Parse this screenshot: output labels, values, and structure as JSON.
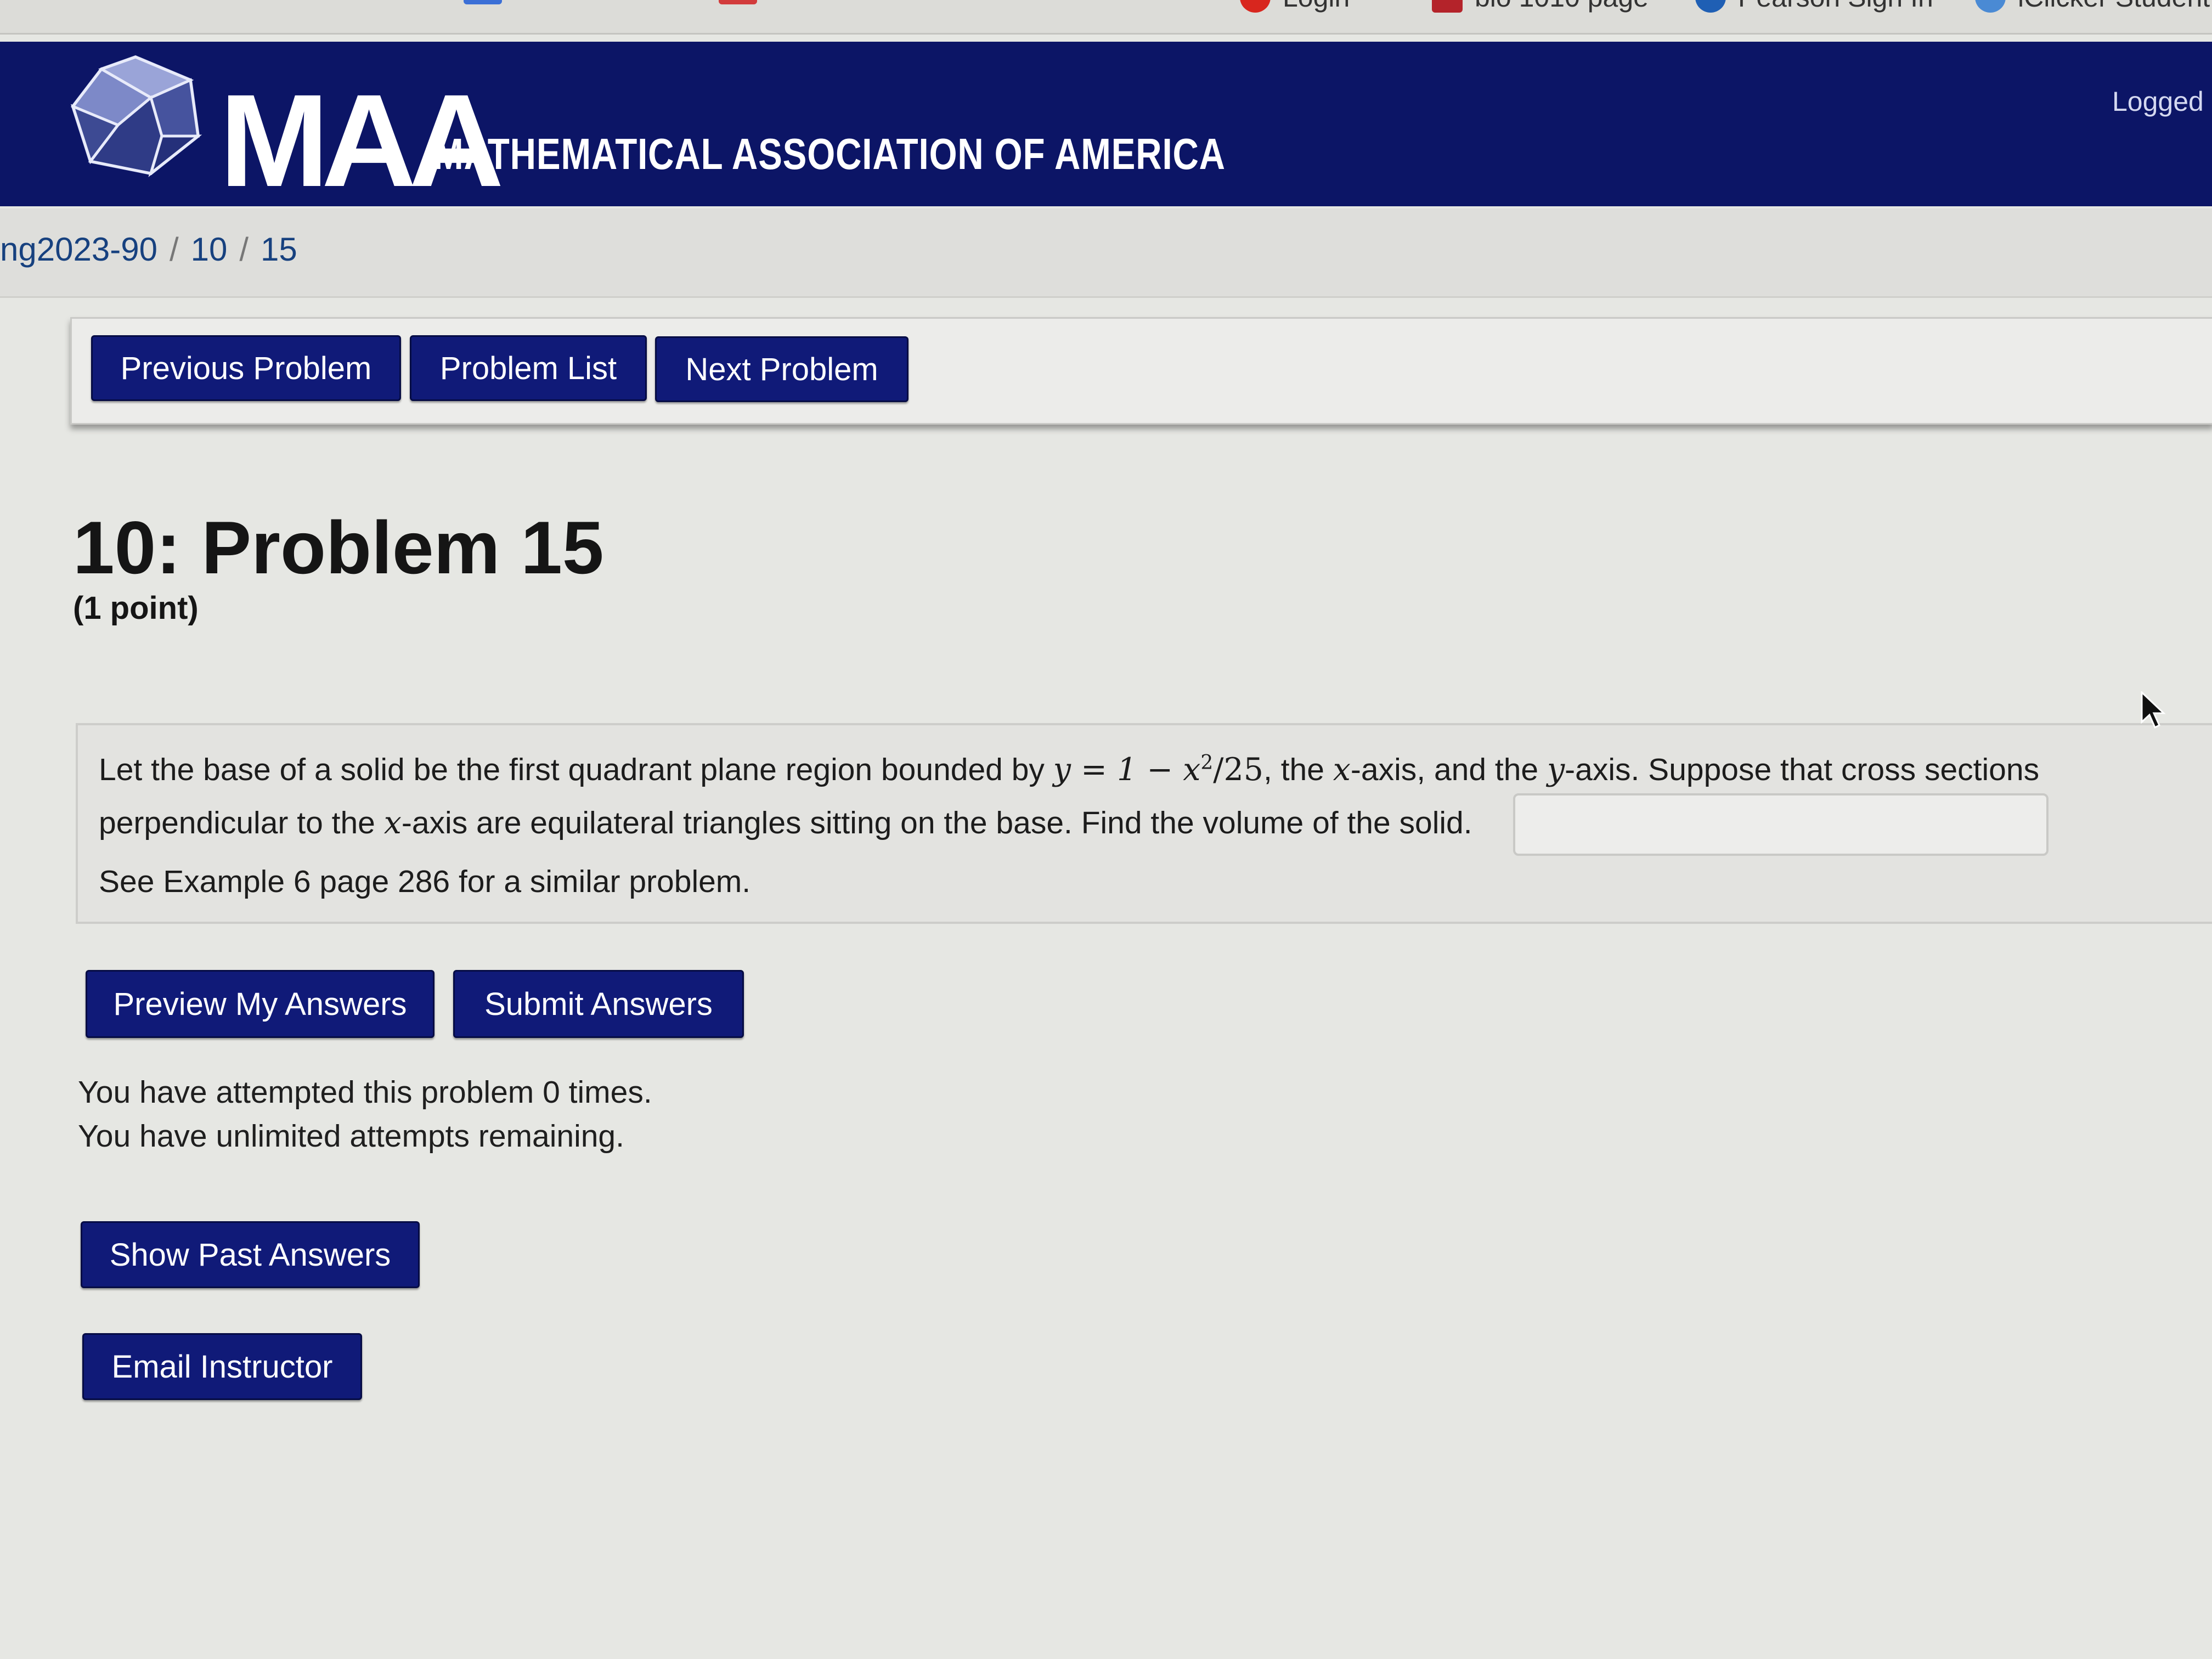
{
  "bookmarks": [
    {
      "label": "Login",
      "icon": "red-circle-icon",
      "color": "#d8261e"
    },
    {
      "label": "bio 1010 page",
      "icon": "book-icon",
      "color": "#b4232a"
    },
    {
      "label": "Pearson Sign In",
      "icon": "pearson-icon",
      "color": "#1f5fb4"
    },
    {
      "label": "iClicker Student",
      "icon": "iclicker-icon",
      "color": "#4a8ad4"
    }
  ],
  "header": {
    "logo_mark": "MAA",
    "logo_text": "MATHEMATICAL ASSOCIATION OF AMERICA",
    "logged_in_text": "Logged i",
    "background_color": "#0c1566"
  },
  "breadcrumb": {
    "items": [
      "ng2023-90",
      "10",
      "15"
    ],
    "separator": "/"
  },
  "nav": {
    "previous": "Previous Problem",
    "list": "Problem List",
    "next": "Next Problem"
  },
  "problem": {
    "title": "10: Problem 15",
    "points": "(1 point)",
    "line1_a": "Let the base of a solid be the first quadrant plane region bounded by ",
    "math_eq": "y = 1 − x",
    "math_exp": "2",
    "math_div": "/25",
    "line1_b": ", the ",
    "var_x": "x",
    "line1_c": "-axis, and the ",
    "var_y": "y",
    "line1_d": "-axis. Suppose that cross sections",
    "line2_a": "perpendicular to the ",
    "line2_b": "-axis are equilateral triangles sitting on the base. Find the volume of the solid.",
    "hint": "See Example 6 page 286 for a similar problem.",
    "answer_value": ""
  },
  "actions": {
    "preview": "Preview My Answers",
    "submit": "Submit Answers",
    "show_past": "Show Past Answers",
    "email": "Email Instructor"
  },
  "attempts": {
    "line1": "You have attempted this problem 0 times.",
    "line2": "You have unlimited attempts remaining."
  },
  "colors": {
    "button": "#101a78",
    "link": "#17417f"
  }
}
